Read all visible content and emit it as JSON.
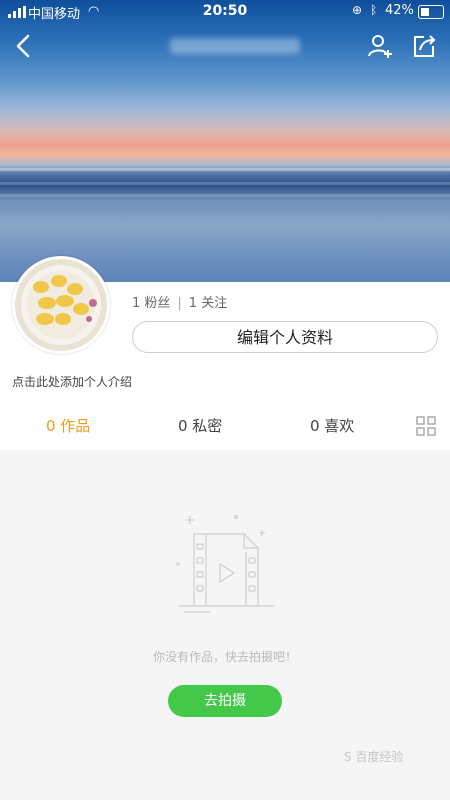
{
  "status_bar": {
    "carrier": "中国移动",
    "time": "20:50",
    "battery_percent": "42%",
    "battery_level": 0.42
  },
  "profile": {
    "followers_label": "1 粉丝",
    "following_label": "1 关注",
    "edit_button": "编辑个人资料",
    "bio_placeholder": "点击此处添加个人介绍"
  },
  "tabs": [
    {
      "label": "0  作品",
      "active": true
    },
    {
      "label": "0  私密",
      "active": false
    },
    {
      "label": "0  喜欢",
      "active": false
    }
  ],
  "empty_state": {
    "message": "你没有作品，快去拍摄吧！",
    "button": "去拍摄"
  },
  "watermark": "S 百度经验",
  "colors": {
    "accent": "#f29a1e",
    "button_green": "#43c84a",
    "muted_text": "#bbbbbb"
  },
  "icons": [
    "back-icon",
    "add-user-icon",
    "share-icon",
    "grid-view-icon",
    "video-file-icon"
  ]
}
